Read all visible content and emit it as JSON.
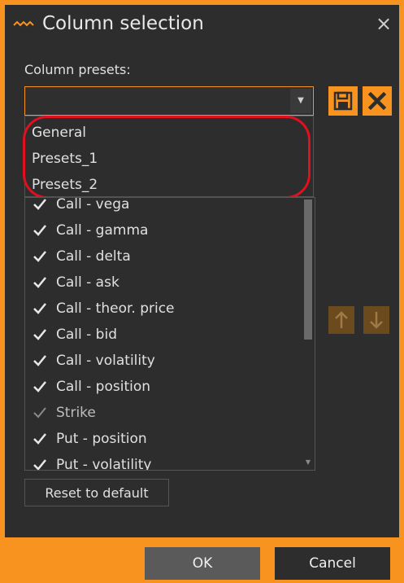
{
  "window": {
    "title": "Column selection",
    "close_glyph": "×"
  },
  "colors": {
    "accent": "#f7931e",
    "background": "#2d2d2d",
    "highlight_ring": "#e01020"
  },
  "presets": {
    "label": "Column presets:",
    "current_value": "",
    "options": [
      "General",
      "Presets_1",
      "Presets_2"
    ]
  },
  "icons": {
    "title": "wave-icon",
    "save": "save-icon",
    "delete": "delete-icon",
    "up": "arrow-up-icon",
    "down": "arrow-down-icon"
  },
  "columns": [
    {
      "label": "Call - vega",
      "checked": true
    },
    {
      "label": "Call - gamma",
      "checked": true
    },
    {
      "label": "Call - delta",
      "checked": true
    },
    {
      "label": "Call - ask",
      "checked": true
    },
    {
      "label": "Call - theor. price",
      "checked": true
    },
    {
      "label": "Call - bid",
      "checked": true
    },
    {
      "label": "Call - volatility",
      "checked": true
    },
    {
      "label": "Call - position",
      "checked": true
    },
    {
      "label": "Strike",
      "checked": true,
      "disabled": true
    },
    {
      "label": "Put - position",
      "checked": true
    },
    {
      "label": "Put - volatility",
      "checked": true
    }
  ],
  "buttons": {
    "reset": "Reset to default",
    "ok": "OK",
    "cancel": "Cancel"
  }
}
